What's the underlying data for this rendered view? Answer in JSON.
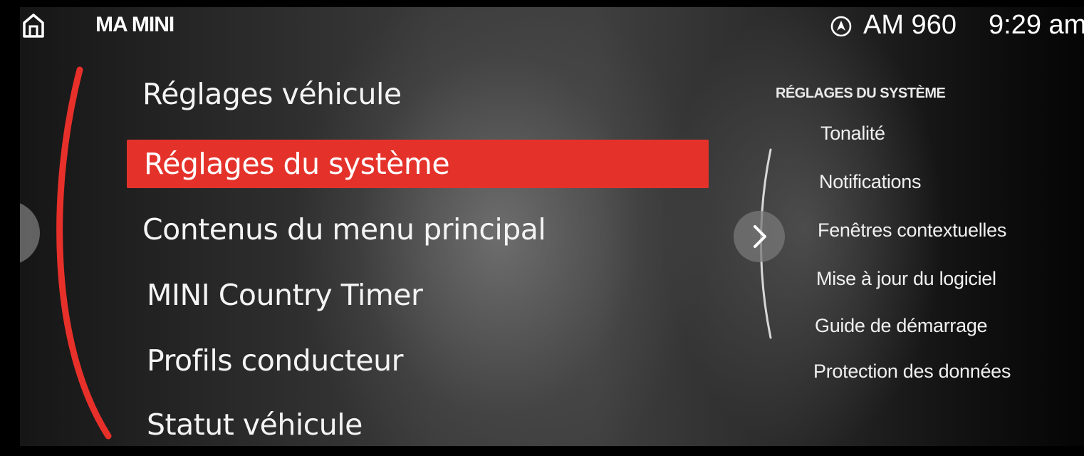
{
  "status_bar": {
    "title": "MA MINI",
    "home_icon": "home-icon",
    "nav_icon": "navigation-arrow-icon",
    "radio": "AM 960",
    "clock": "9:29 am"
  },
  "main_menu": {
    "items": [
      {
        "label": "Réglages véhicule",
        "selected": false
      },
      {
        "label": "Réglages du système",
        "selected": true
      },
      {
        "label": "Contenus du menu principal",
        "selected": false
      },
      {
        "label": "MINI Country Timer",
        "selected": false
      },
      {
        "label": "Profils conducteur",
        "selected": false
      },
      {
        "label": "Statut véhicule",
        "selected": false
      }
    ]
  },
  "submenu": {
    "heading": "RÉGLAGES DU SYSTÈME",
    "items": [
      {
        "label": "Tonalité"
      },
      {
        "label": "Notifications"
      },
      {
        "label": "Fenêtres contextuelles"
      },
      {
        "label": "Mise à jour du logiciel"
      },
      {
        "label": "Guide de démarrage"
      },
      {
        "label": "Protection des données"
      }
    ]
  },
  "colors": {
    "accent": "#e4322b",
    "text": "#f2f2f2",
    "arc": "#e8302a"
  }
}
